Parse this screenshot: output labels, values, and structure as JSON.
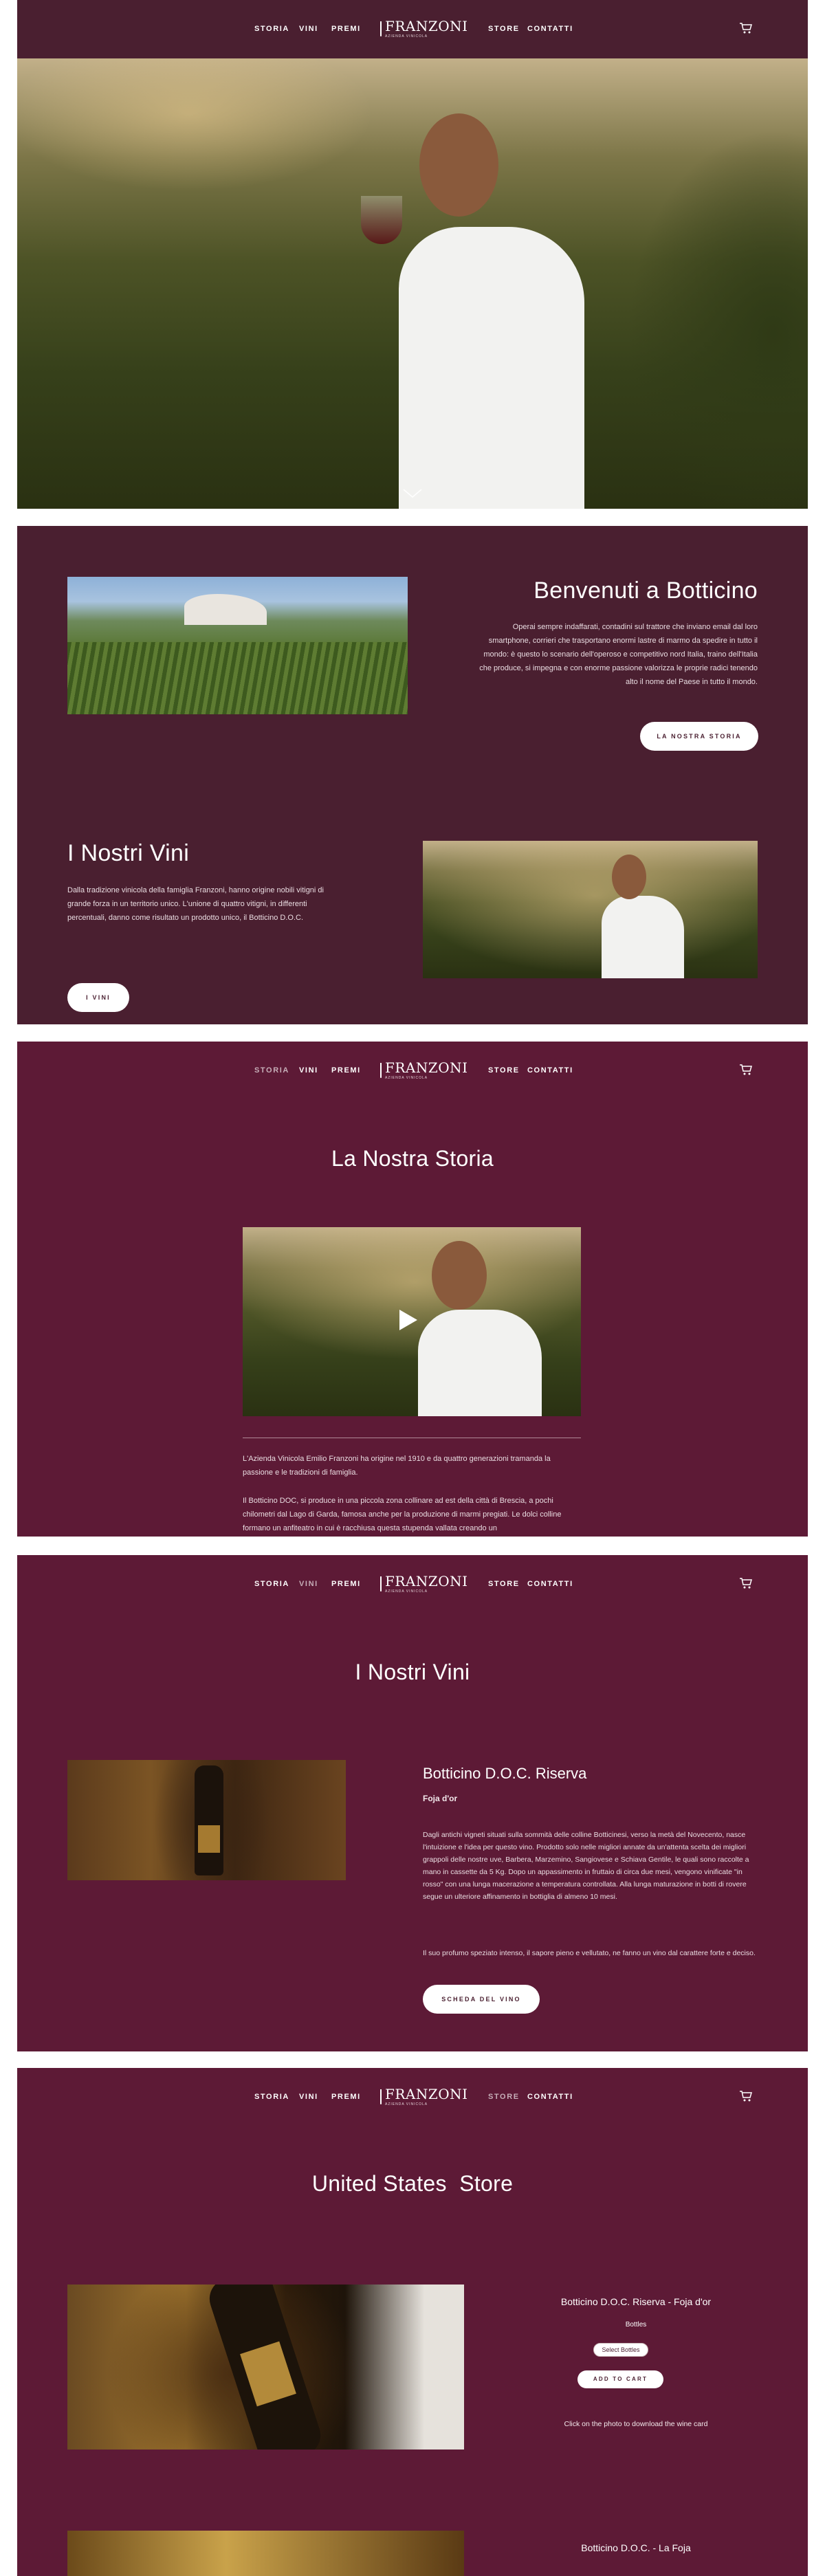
{
  "nav": {
    "items_left": [
      "STORIA",
      "VINI",
      "PREMI"
    ],
    "items_right": [
      "STORE",
      "CONTATTI"
    ],
    "logo_text": "FRANZONI",
    "logo_sub": "AZIENDA VINICOLA"
  },
  "home": {
    "welcome_title": "Benvenuti a Botticino",
    "welcome_text": "Operai sempre indaffarati, contadini sul trattore che inviano email dal loro smartphone, corrieri che trasportano enormi lastre di marmo da spedire in tutto il mondo: è questo lo scenario dell'operoso e competitivo nord Italia, traino dell'Italia che produce, si impegna e con enorme passione valorizza le proprie radici tenendo alto il nome del Paese in tutto il mondo.",
    "welcome_button": "LA NOSTRA STORIA",
    "wines_title": "I Nostri Vini",
    "wines_text": "Dalla tradizione vinicola della famiglia Franzoni, hanno origine nobili vitigni di grande forza in un territorio unico. L'unione di quattro vitigni, in differenti percentuali, danno come risultato un prodotto unico, il Botticino D.O.C.",
    "wines_button": "I VINI"
  },
  "story": {
    "title": "La Nostra Storia",
    "para1": "L'Azienda Vinicola Emilio Franzoni ha origine nel 1910 e da quattro generazioni tramanda la passione e le tradizioni di famiglia.",
    "para2": "Il Botticino DOC, si produce in una piccola zona collinare ad est della città di Brescia, a pochi chilometri dal Lago di Garda, famosa anche per la produzione di marmi pregiati. Le dolci colline formano un anfiteatro in cui è racchiusa questa stupenda vallata creando un"
  },
  "wines": {
    "title": "I Nostri Vini",
    "product_name": "Botticino D.O.C. Riserva",
    "product_sub": "Foja d'or",
    "desc1": "Dagli antichi vigneti situati sulla sommità delle colline Botticinesi, verso la metà del Novecento, nasce l'intuizione e l'idea per questo vino. Prodotto solo nelle migliori annate da un'attenta scelta dei migliori grappoli delle nostre uve, Barbera, Marzemino, Sangiovese e Schiava Gentile, le quali sono raccolte a mano in cassette da 5 Kg. Dopo un appassimento in fruttaio di circa due mesi, vengono vinificate \"in rosso\" con una lunga macerazione a temperatura controllata. Alla lunga maturazione in botti di rovere segue un ulteriore affinamento in bottiglia di almeno 10 mesi.",
    "desc2": "Il suo profumo speziato intenso, il sapore pieno e vellutato, ne fanno un vino dal carattere forte e deciso.",
    "button": "SCHEDA DEL VINO"
  },
  "store": {
    "title": "United States  Store",
    "product1": "Botticino D.O.C. Riserva - Foja d'or",
    "bottles_label": "Bottles",
    "select_label": "Select Bottles",
    "add_to_cart": "ADD TO CART",
    "note": "Click on the photo to download the wine card",
    "product2": "Botticino D.O.C. - La Foja"
  },
  "colors": {
    "panel_dark": "#4a1f30",
    "panel_wine": "#5d1a36",
    "button_bg": "#ffffff"
  }
}
